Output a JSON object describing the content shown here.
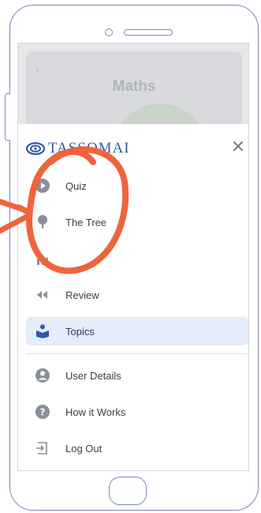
{
  "background_page": {
    "title": "Maths",
    "back_glyph": "‹"
  },
  "drawer": {
    "logo_text": "TASSOMAI",
    "close_glyph": "✕",
    "items": [
      {
        "label": "Quiz",
        "icon": "play-icon"
      },
      {
        "label": "The Tree",
        "icon": "tree-icon"
      },
      {
        "label": "",
        "icon": "bar-chart-icon"
      },
      {
        "label": "Review",
        "icon": "rewind-icon"
      },
      {
        "label": "Topics",
        "icon": "book-reader-icon",
        "active": true
      }
    ],
    "account_items": [
      {
        "label": "User Details",
        "icon": "user-icon"
      },
      {
        "label": "How it Works",
        "icon": "help-icon"
      },
      {
        "label": "Log Out",
        "icon": "logout-icon"
      }
    ]
  },
  "colors": {
    "accent": "#2f5aa8",
    "annotation": "#f0643c",
    "active_bg": "#e5ecfa",
    "frame": "#7c87c6"
  }
}
